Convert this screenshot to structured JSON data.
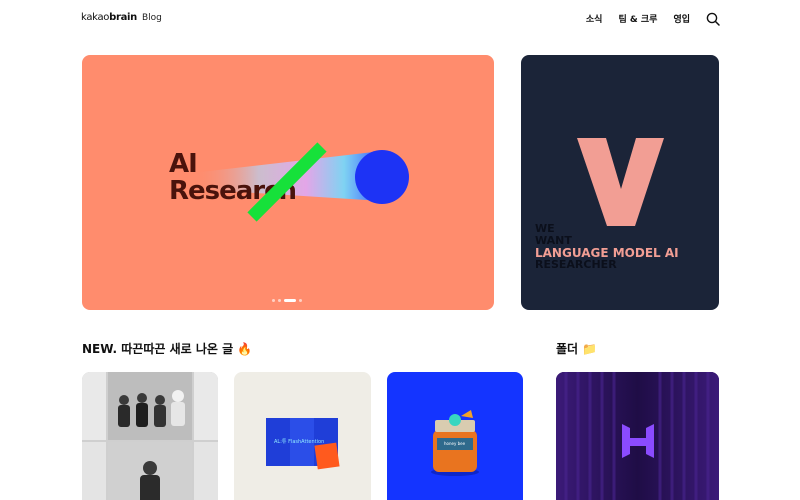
{
  "header": {
    "logo_brand": "kakaobrain",
    "logo_blog": "Blog",
    "nav": [
      "소식",
      "팀 & 크루",
      "영입"
    ]
  },
  "hero": {
    "main_title": "AI\nResearch",
    "side_lines": [
      "WE",
      "WANT",
      "LANGUAGE MODEL AI",
      "RESEARCHER"
    ],
    "side_letter": "V",
    "carousel_active": 2,
    "carousel_count": 4
  },
  "sections": {
    "new_title": "NEW. 따끈따끈 새로 나온 글 🔥",
    "folder_title": "폴더 📁"
  },
  "cards": {
    "card2_label": "AL:튜 FlashAttention",
    "card3_label": "honey bee"
  },
  "colors": {
    "hero_main_bg": "#ff8c6d",
    "hero_side_bg": "#1b2438",
    "accent_green": "#16e13a",
    "accent_blue": "#1434ff",
    "side_pink": "#f29e94"
  }
}
